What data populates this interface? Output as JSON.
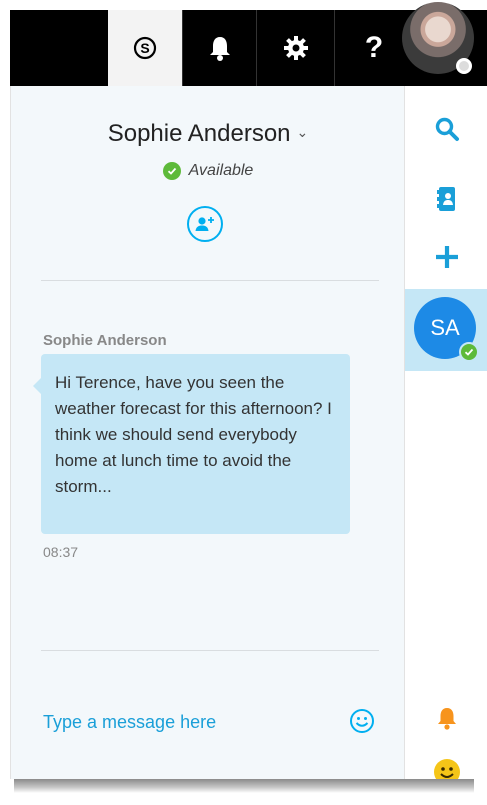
{
  "topbar": {
    "skype_icon": "skype-icon",
    "bell_icon": "bell-icon",
    "gear_icon": "gear-icon",
    "help_label": "?"
  },
  "conversation": {
    "contact_name": "Sophie Anderson",
    "presence": "Available",
    "message": {
      "sender": "Sophie Anderson",
      "text": "Hi Terence, have you seen the weather forecast for this afternoon? I think we should send everybody home at lunch time to avoid the storm...",
      "time": "08:37"
    },
    "input_placeholder": "Type a message here"
  },
  "sidebar": {
    "active_chat_initials": "SA"
  },
  "colors": {
    "accent": "#00aff0",
    "bubble": "#c5e7f6",
    "online": "#5dba3a",
    "notification": "#f7941d",
    "emoji": "#f5c518"
  }
}
